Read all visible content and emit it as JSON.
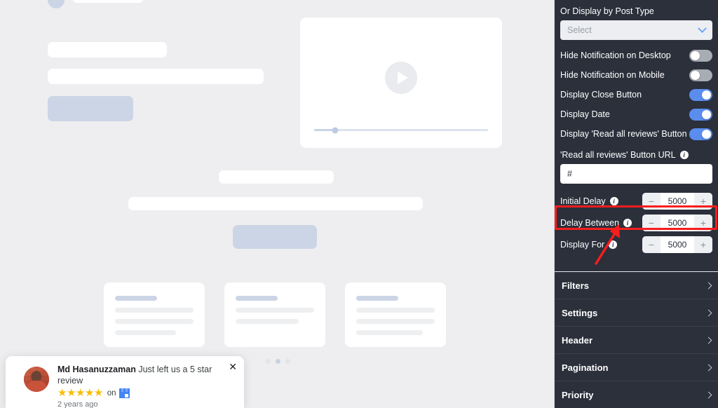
{
  "preview": {
    "video": {
      "play_icon": "play-icon",
      "progress_percent": 12
    },
    "cards": [
      {
        "lines": [
          84,
          84,
          66
        ]
      },
      {
        "lines": [
          84,
          68
        ]
      },
      {
        "lines": [
          84,
          84,
          72
        ]
      }
    ],
    "pagination_dots": 3,
    "pagination_active_index": 1
  },
  "review_popup": {
    "name": "Md Hasanuzzaman",
    "text": "Just left us a 5 star review",
    "stars": 5,
    "star_glyph": "★",
    "on_label": "on",
    "source_icon": "google-business-profile-icon",
    "time": "2 years ago",
    "close_glyph": "✕",
    "avatar_alt": "reviewer-avatar"
  },
  "sidebar": {
    "post_type": {
      "label": "Or Display by Post Type",
      "select_placeholder": "Select",
      "chevron_icon": "chevron-down-icon"
    },
    "toggles": [
      {
        "label": "Hide Notification on Desktop",
        "on": false
      },
      {
        "label": "Hide Notification on Mobile",
        "on": false
      },
      {
        "label": "Display Close Button",
        "on": true
      },
      {
        "label": "Display Date",
        "on": true
      },
      {
        "label": "Display 'Read all reviews' Button",
        "on": true
      }
    ],
    "button_url": {
      "label": "'Read all reviews' Button URL",
      "info_icon": "info-icon",
      "value": "#"
    },
    "steppers": [
      {
        "label": "Initial Delay",
        "value": "5000",
        "minus": "−",
        "plus": "+",
        "info_icon": "info-icon"
      },
      {
        "label": "Delay Between",
        "value": "5000",
        "minus": "−",
        "plus": "+",
        "info_icon": "info-icon"
      },
      {
        "label": "Display For",
        "value": "5000",
        "minus": "−",
        "plus": "+",
        "info_icon": "info-icon"
      }
    ],
    "accordions": [
      {
        "label": "Filters",
        "chevron_icon": "chevron-right-icon"
      },
      {
        "label": "Settings",
        "chevron_icon": "chevron-right-icon"
      },
      {
        "label": "Header",
        "chevron_icon": "chevron-right-icon"
      },
      {
        "label": "Pagination",
        "chevron_icon": "chevron-right-icon"
      },
      {
        "label": "Priority",
        "chevron_icon": "chevron-right-icon"
      }
    ]
  },
  "annotations": {
    "highlight_color": "#f91d1d",
    "arrow_color": "#f91d1d",
    "highlight_target": "Delay Between"
  },
  "colors": {
    "sidebar_bg": "#2b303b",
    "preview_bg": "#eeeef0",
    "toggle_on": "#5b8def",
    "toggle_off": "#a8acb3",
    "accent_blue": "#6fa8f5",
    "star_gold": "#fbbc04"
  }
}
